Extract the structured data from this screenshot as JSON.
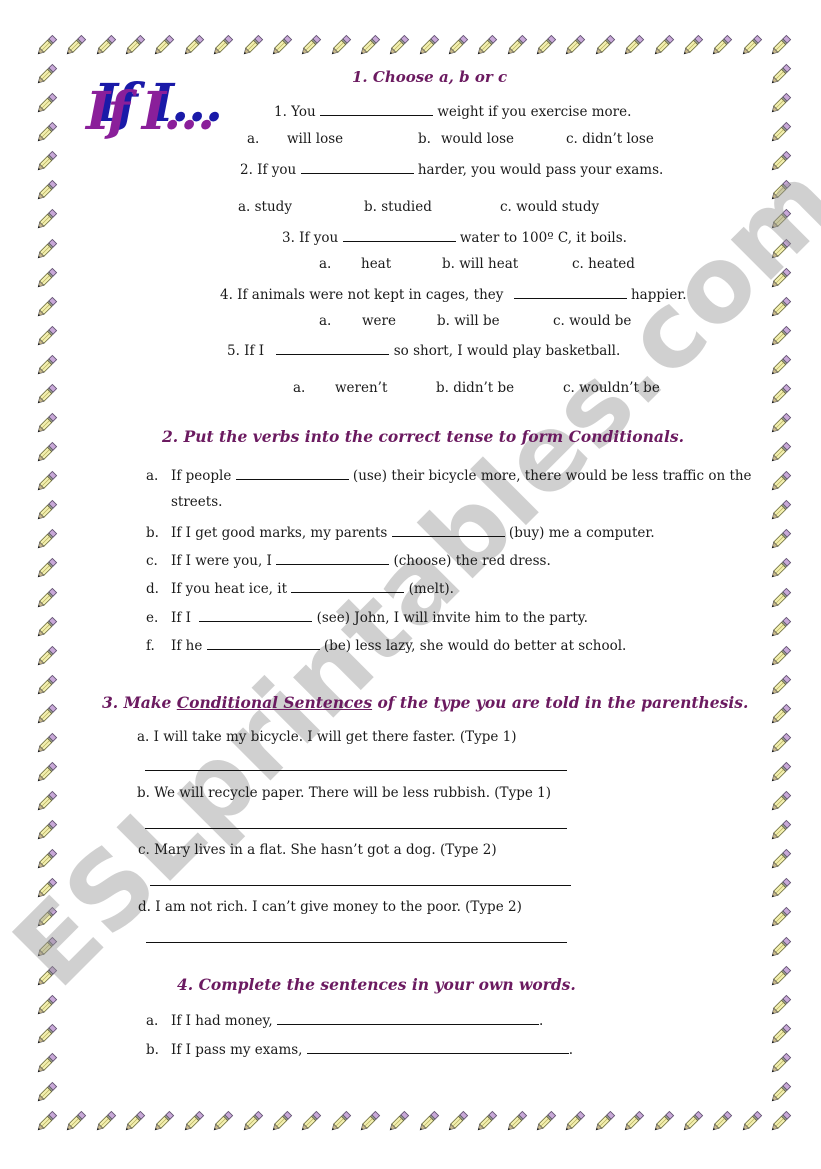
{
  "logo": {
    "text": "If I…"
  },
  "watermark": "ESLprintables.com",
  "colors": {
    "heading": "#6b1a60",
    "logo_front": "#8a1f9a",
    "logo_shadow": "#1a1aa8",
    "watermark": "#969696"
  },
  "section1": {
    "title": "1. Choose a, b or c",
    "questions": [
      {
        "pre": "1. You",
        "post": "weight if you exercise more.",
        "options": [
          "a.",
          "will lose",
          "b.",
          "would lose",
          "c. didn’t lose"
        ]
      },
      {
        "pre": "2. If you",
        "post": "harder, you would pass your exams.",
        "options": [
          "a. study",
          "b.  studied",
          "c. would study"
        ]
      },
      {
        "pre": "3. If you",
        "post": "water to 100º C, it boils.",
        "options": [
          "a.",
          "heat",
          "b.  will heat",
          "c. heated"
        ]
      },
      {
        "pre": "4. If animals were not kept in cages, they",
        "post": "happier.",
        "options": [
          "a.",
          "were",
          "b. will be",
          "c. would be"
        ]
      },
      {
        "pre": "5. If I",
        "post": "so short, I would play basketball.",
        "options": [
          "a.",
          "weren’t",
          "b. didn’t be",
          "c. wouldn’t be"
        ]
      }
    ]
  },
  "section2": {
    "title": "2. Put the verbs into the correct tense to form Conditionals.",
    "items": [
      {
        "letter": "a.",
        "pre": "If people",
        "post": "(use) their bicycle more, there would be less traffic on the",
        "cont": "streets."
      },
      {
        "letter": "b.",
        "pre": "If I get good marks, my parents",
        "post": "(buy) me a computer."
      },
      {
        "letter": "c.",
        "pre": "If I were you, I",
        "post": "(choose) the red dress."
      },
      {
        "letter": "d.",
        "pre": "If you heat ice, it",
        "post": "(melt)."
      },
      {
        "letter": "e.",
        "pre": "If I",
        "post": "(see) John, I will invite him to the party."
      },
      {
        "letter": "f.",
        "pre": "If he",
        "post": "(be) less lazy, she would do better at school."
      }
    ]
  },
  "section3": {
    "title_pre": "3. Make ",
    "title_underlined": "Conditional Sentences",
    "title_post": " of the type you are told in the parenthesis.",
    "items": [
      "a. I will take my bicycle. I will get there faster. (Type 1)",
      "b. We will recycle paper. There will be less rubbish.  (Type 1)",
      "c. Mary lives in a flat. She hasn’t got a dog. (Type 2)",
      "d. I am not rich. I can’t give money to the poor.  (Type 2)"
    ]
  },
  "section4": {
    "title": "4. Complete the sentences in your own words.",
    "items": [
      {
        "letter": "a.",
        "pre": "If I had money,",
        "post": "."
      },
      {
        "letter": "b.",
        "pre": "If I pass my exams,",
        "post": "."
      }
    ]
  }
}
